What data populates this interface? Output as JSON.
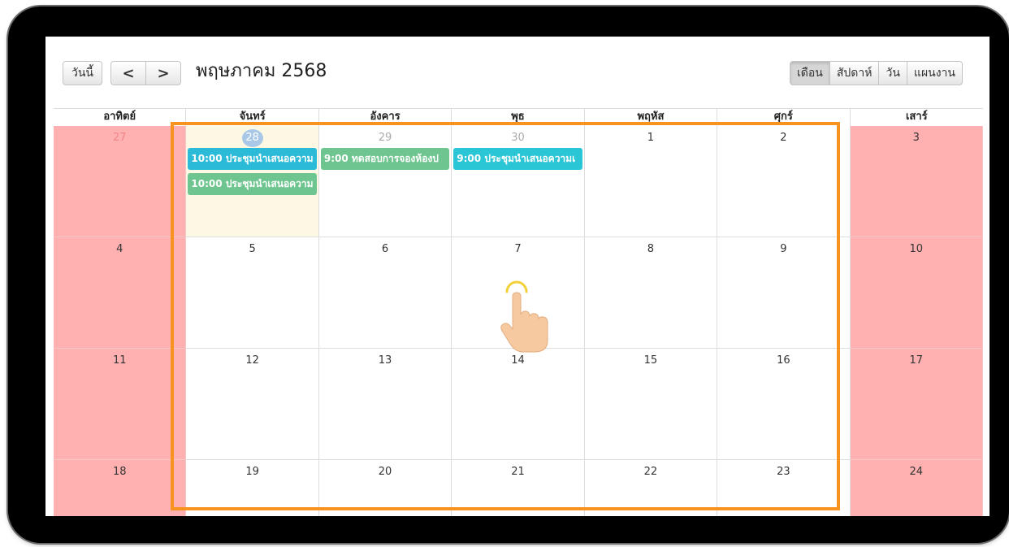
{
  "toolbar": {
    "today_label": "วันนี้",
    "prev_label": "<",
    "next_label": ">",
    "title": "พฤษภาคม 2568",
    "views": [
      {
        "label": "เดือน",
        "active": true
      },
      {
        "label": "สัปดาห์",
        "active": false
      },
      {
        "label": "วัน",
        "active": false
      },
      {
        "label": "แผนงาน",
        "active": false
      }
    ]
  },
  "day_headers": [
    "อาทิตย์",
    "จันทร์",
    "อังคาร",
    "พุธ",
    "พฤหัส",
    "ศุกร์",
    "เสาร์"
  ],
  "weeks": [
    [
      {
        "day": "27",
        "other_month": true
      },
      {
        "day": "28",
        "other_month": true,
        "today": true,
        "events": [
          {
            "time": "10:00",
            "title": "ประชุมนำเสนอความ",
            "color": "#2bbbd8"
          },
          {
            "time": "10:00",
            "title": "ประชุมนำเสนอความ",
            "color": "#6fc58f"
          }
        ]
      },
      {
        "day": "29",
        "other_month": true,
        "events": [
          {
            "time": "9:00",
            "title": "ทดสอบการจองห้องป",
            "color": "#6fc58f"
          }
        ]
      },
      {
        "day": "30",
        "other_month": true,
        "events": [
          {
            "time": "9:00",
            "title": "ประชุมนำเสนอความเ",
            "color": "#2bc6d6"
          }
        ]
      },
      {
        "day": "1"
      },
      {
        "day": "2"
      },
      {
        "day": "3"
      }
    ],
    [
      {
        "day": "4"
      },
      {
        "day": "5"
      },
      {
        "day": "6"
      },
      {
        "day": "7"
      },
      {
        "day": "8"
      },
      {
        "day": "9"
      },
      {
        "day": "10"
      }
    ],
    [
      {
        "day": "11"
      },
      {
        "day": "12"
      },
      {
        "day": "13"
      },
      {
        "day": "14"
      },
      {
        "day": "15"
      },
      {
        "day": "16"
      },
      {
        "day": "17"
      }
    ],
    [
      {
        "day": "18"
      },
      {
        "day": "19"
      },
      {
        "day": "20"
      },
      {
        "day": "21"
      },
      {
        "day": "22"
      },
      {
        "day": "23"
      },
      {
        "day": "24"
      }
    ]
  ],
  "colors": {
    "weekend_bg": "#ffb1b1",
    "today_bg": "#fcf8e3",
    "highlight_border": "#f7931e",
    "today_circle": "#a9c8e8"
  },
  "icons": {
    "tap_cursor": "pointing-hand-icon"
  }
}
